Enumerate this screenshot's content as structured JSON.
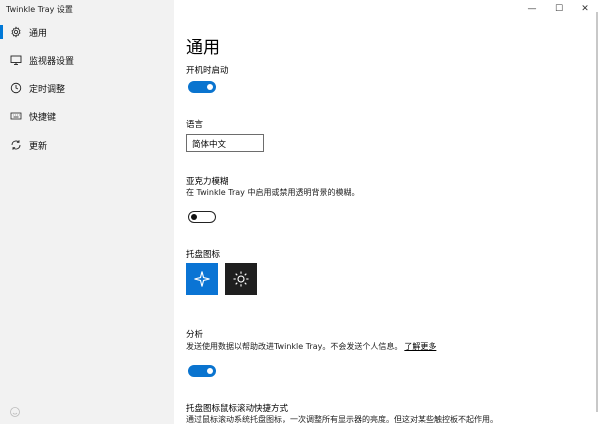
{
  "window": {
    "title": "Twinkle Tray 设置"
  },
  "titlebar": {
    "minimize": "—",
    "maximize": "☐",
    "close": "✕"
  },
  "sidebar": {
    "items": [
      {
        "label": "通用",
        "icon": "gear-icon",
        "selected": true
      },
      {
        "label": "监视器设置",
        "icon": "monitor-icon"
      },
      {
        "label": "定时调整",
        "icon": "clock-icon"
      },
      {
        "label": "快捷键",
        "icon": "keyboard-icon"
      },
      {
        "label": "更新",
        "icon": "refresh-icon"
      }
    ]
  },
  "main": {
    "title": "通用",
    "startup": {
      "label": "开机时启动",
      "enabled": true
    },
    "language": {
      "label": "语言",
      "value": "简体中文"
    },
    "acrylic": {
      "label": "亚克力模糊",
      "desc": "在 Twinkle Tray 中启用或禁用透明背景的模糊。",
      "enabled": false
    },
    "tray_icon": {
      "label": "托盘图标",
      "options": [
        "light-icon",
        "dark-icon"
      ],
      "selected": 0
    },
    "analytics": {
      "label": "分析",
      "desc": "发送使用数据以帮助改进Twinkle Tray。不会发送个人信息。",
      "link": "了解更多",
      "enabled": true
    },
    "scroll": {
      "label": "托盘图标鼠标滚动快捷方式",
      "desc": "通过鼠标滚动系统托盘图标，一次调整所有显示器的亮度。但这对某些触控板不起作用。"
    }
  },
  "colors": {
    "accent": "#0a74cf",
    "sidebar_bg": "#f2f2f2"
  }
}
